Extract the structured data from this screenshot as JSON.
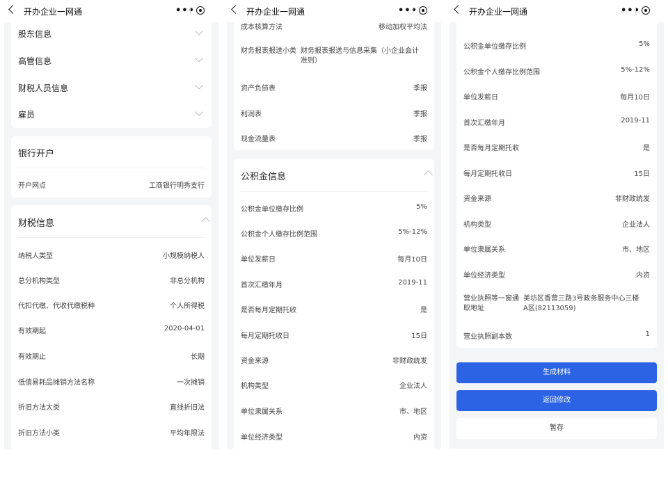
{
  "app": {
    "title": "开办企业一网通",
    "more_icon": "more-dots-icon",
    "close_icon": "capsule-close-icon"
  },
  "panel1": {
    "collapsed_items": [
      "股东信息",
      "高管信息",
      "财税人员信息",
      "雇员"
    ],
    "bank": {
      "title": "银行开户",
      "rows": [
        {
          "label": "开户网点",
          "value": "工商银行明秀支行"
        }
      ]
    },
    "tax": {
      "title": "财税信息",
      "rows": [
        {
          "label": "纳税人类型",
          "value": "小规模纳税人"
        },
        {
          "label": "总分机构类型",
          "value": "非总分机构"
        },
        {
          "label": "代扣代缴、代收代缴税种",
          "value": "个人所得税"
        },
        {
          "label": "有效期起",
          "value": "2020-04-01"
        },
        {
          "label": "有效期止",
          "value": "长期"
        },
        {
          "label": "低值易耗品摊销方法名称",
          "value": "一次摊销"
        },
        {
          "label": "折旧方法大类",
          "value": "直线折旧法"
        },
        {
          "label": "折旧方法小类",
          "value": "平均年限法"
        }
      ]
    }
  },
  "panel2": {
    "top_rows": [
      {
        "label": "成本核算方法",
        "value": "移动加权平均法"
      },
      {
        "label": "财务报表报送小类",
        "value": "财务报表报送与信息采集（小企业会计准则）"
      },
      {
        "label": "资产负债表",
        "value": "季报"
      },
      {
        "label": "利润表",
        "value": "季报"
      },
      {
        "label": "现金流量表",
        "value": "季报"
      }
    ],
    "fund": {
      "title": "公积金信息",
      "rows": [
        {
          "label": "公积金单位缴存比例",
          "value": "5%"
        },
        {
          "label": "公积金个人缴存比例范围",
          "value": "5%-12%"
        },
        {
          "label": "单位发薪日",
          "value": "每月10日"
        },
        {
          "label": "首次汇缴年月",
          "value": "2019-11"
        },
        {
          "label": "是否每月定期托收",
          "value": "是"
        },
        {
          "label": "每月定期托收日",
          "value": "15日"
        },
        {
          "label": "资金来源",
          "value": "非财政统发"
        },
        {
          "label": "机构类型",
          "value": "企业法人"
        },
        {
          "label": "单位隶属关系",
          "value": "市、地区"
        },
        {
          "label": "单位经济类型",
          "value": "内资"
        }
      ]
    }
  },
  "panel3": {
    "rows": [
      {
        "label": "公积金单位缴存比例",
        "value": "5%"
      },
      {
        "label": "公积金个人缴存比例范围",
        "value": "5%-12%"
      },
      {
        "label": "单位发薪日",
        "value": "每月10日"
      },
      {
        "label": "首次汇缴年月",
        "value": "2019-11"
      },
      {
        "label": "是否每月定期托收",
        "value": "是"
      },
      {
        "label": "每月定期托收日",
        "value": "15日"
      },
      {
        "label": "资金来源",
        "value": "非财政统发"
      },
      {
        "label": "机构类型",
        "value": "企业法人"
      },
      {
        "label": "单位隶属关系",
        "value": "市、地区"
      },
      {
        "label": "单位经济类型",
        "value": "内资"
      },
      {
        "label": "营业执照等一窗通取地址",
        "value": "美坊区香营三路3号政务服务中心三楼A区(82113059)"
      },
      {
        "label": "营业执照副本数",
        "value": "1"
      }
    ],
    "buttons": {
      "generate": "生成材料",
      "back_edit": "返回修改",
      "save_draft": "暂存"
    }
  },
  "colors": {
    "primary": "#2b63e4",
    "background": "#f4f5f7",
    "card": "#ffffff"
  }
}
